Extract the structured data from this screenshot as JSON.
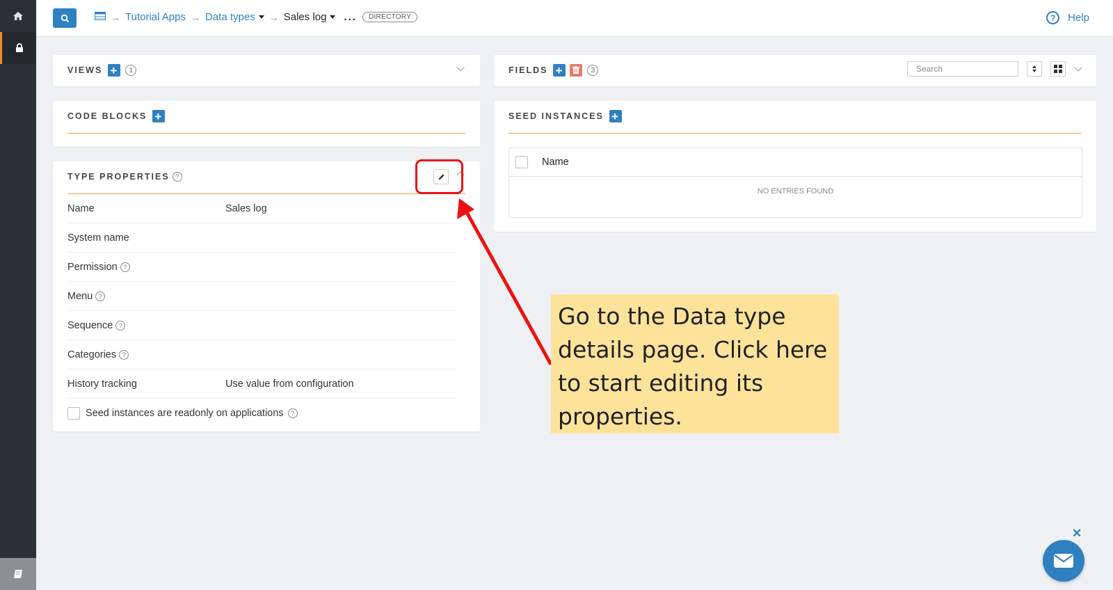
{
  "sidebar": {
    "items": [
      {
        "icon": "home-icon"
      },
      {
        "icon": "lock-icon"
      },
      {
        "icon": "book-icon"
      }
    ]
  },
  "breadcrumb": {
    "home_icon": "table-icon",
    "items": [
      "Tutorial Apps",
      "Data types",
      "Sales log"
    ],
    "dots": "...",
    "badge": "DIRECTORY"
  },
  "help": {
    "label": "Help"
  },
  "views": {
    "title": "VIEWS",
    "count": "1"
  },
  "code_blocks": {
    "title": "CODE BLOCKS"
  },
  "type_properties": {
    "title": "TYPE PROPERTIES",
    "rows": [
      {
        "label": "Name",
        "value": "Sales log"
      },
      {
        "label": "System name",
        "value": ""
      },
      {
        "label": "Permission",
        "value": ""
      },
      {
        "label": "Menu",
        "value": ""
      },
      {
        "label": "Sequence",
        "value": ""
      },
      {
        "label": "Categories",
        "value": ""
      },
      {
        "label": "History tracking",
        "value": "Use value from configuration"
      }
    ],
    "checkbox_label": "Seed instances are readonly on applications"
  },
  "fields": {
    "title": "FIELDS",
    "count": "3",
    "search_placeholder": "Search"
  },
  "seed_instances": {
    "title": "SEED INSTANCES",
    "column": "Name",
    "empty_text": "NO ENTRIES FOUND"
  },
  "annotation": {
    "text": "Go to the Data type details page. Click here to start editing its properties."
  },
  "colors": {
    "accent": "#2f80c0",
    "highlight": "#ee1111",
    "callout": "#fde39a",
    "divider": "#f0a04b"
  }
}
